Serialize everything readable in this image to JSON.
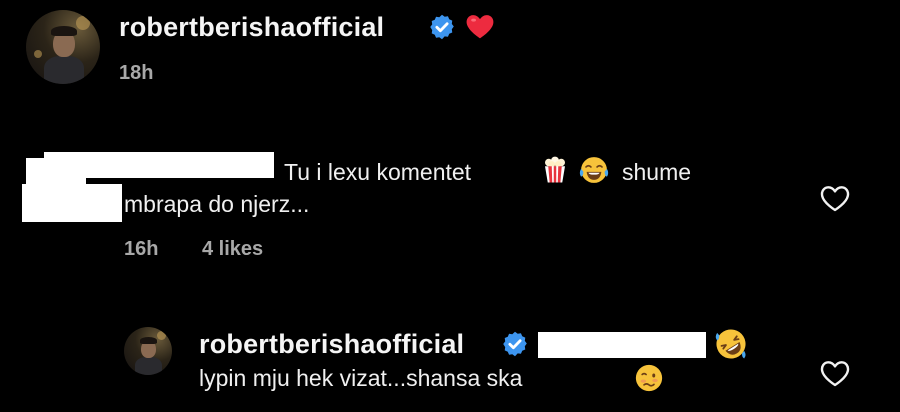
{
  "caption": {
    "username": "robertberishaofficial",
    "time": "18h",
    "heart_emoji": "heart",
    "verified_icon": "verified-badge-icon"
  },
  "comment": {
    "text_line1": "Tu i lexu komentet",
    "text_line1_end": "shume",
    "text_line2": "mbrapa do njerz...",
    "emoji1": "popcorn",
    "emoji2": "tears-of-joy",
    "time": "16h",
    "likes": "4 likes",
    "like_icon": "heart-outline-icon"
  },
  "reply": {
    "username": "robertberishaofficial",
    "text": "lypin mju hek vizat...shansa ska",
    "emoji_rofl": "rolling-on-floor-laughing",
    "emoji_end": "woozy-face",
    "like_icon": "heart-outline-icon"
  },
  "colors": {
    "background": "#000000",
    "verified": "#3d95ef",
    "heart_red": "#ed2b3f",
    "muted_text": "#a8a8a8"
  }
}
